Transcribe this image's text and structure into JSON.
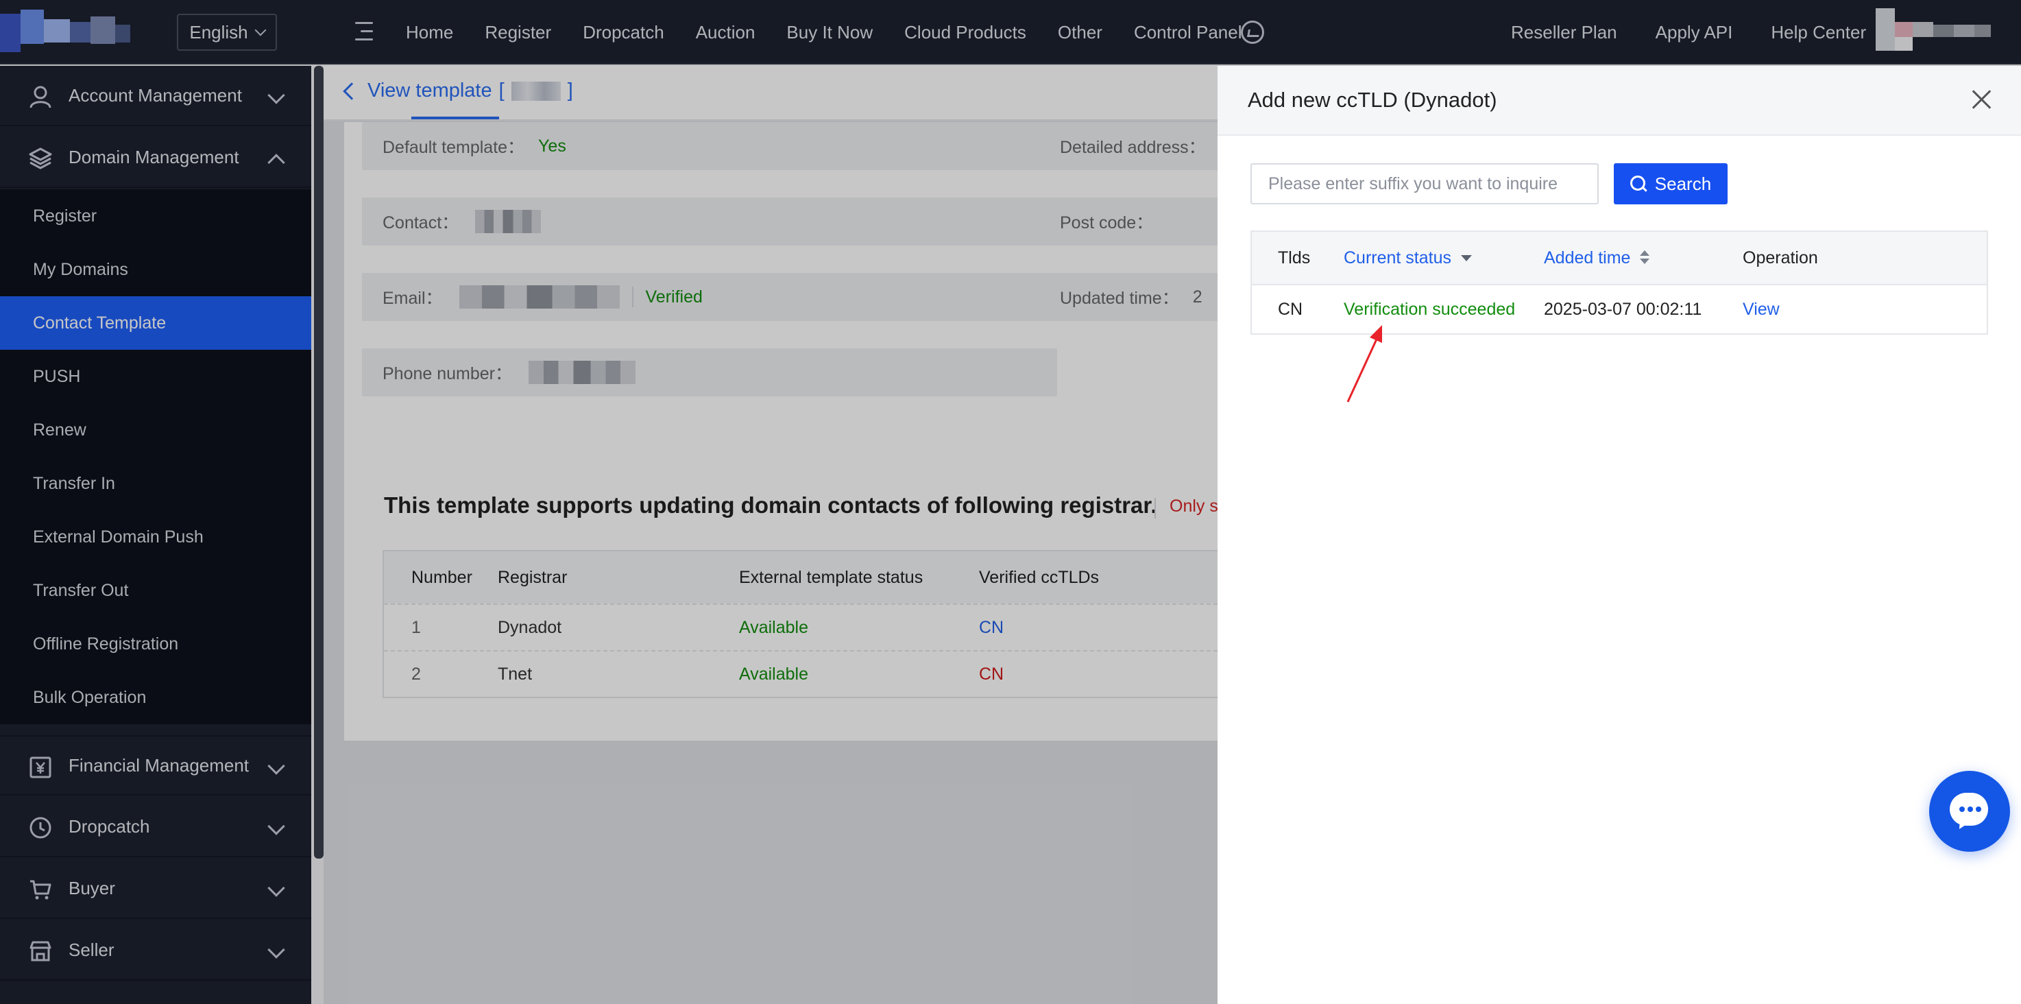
{
  "header": {
    "language": "English",
    "nav": [
      "Home",
      "Register",
      "Dropcatch",
      "Auction",
      "Buy It Now",
      "Cloud Products",
      "Other",
      "Control Panel"
    ],
    "nav_right": [
      "Reseller Plan",
      "Apply API",
      "Help Center"
    ]
  },
  "sidebar": {
    "account": "Account Management",
    "domain": "Domain Management",
    "domain_items": [
      "Register",
      "My Domains",
      "Contact Template",
      "PUSH",
      "Renew",
      "Transfer In",
      "External Domain Push",
      "Transfer Out",
      "Offline Registration",
      "Bulk Operation"
    ],
    "active_item": "Contact Template",
    "financial": "Financial Management",
    "dropcatch": "Dropcatch",
    "buyer": "Buyer",
    "seller": "Seller"
  },
  "main": {
    "breadcrumb": "View template",
    "bracket_open": "[",
    "bracket_close": "]",
    "fields": {
      "default_template_label": "Default template：",
      "default_template_value": "Yes",
      "contact_label": "Contact：",
      "email_label": "Email：",
      "email_status": "Verified",
      "phone_label": "Phone number：",
      "address_label": "Detailed address：",
      "postcode_label": "Post code：",
      "updated_label": "Updated time：",
      "updated_value": "2"
    },
    "registrar_section": {
      "title": "This template supports updating domain contacts of following registrar.",
      "note": "Only stat",
      "columns": [
        "Number",
        "Registrar",
        "External template status",
        "Verified ccTLDs"
      ],
      "rows": [
        {
          "number": "1",
          "registrar": "Dynadot",
          "status": "Available",
          "cctlds": "CN"
        },
        {
          "number": "2",
          "registrar": "Tnet",
          "status": "Available",
          "cctlds": "CN"
        }
      ]
    }
  },
  "drawer": {
    "title": "Add new ccTLD (Dynadot)",
    "search_placeholder": "Please enter suffix you want to inquire",
    "search_button": "Search",
    "columns": {
      "tlds": "Tlds",
      "status": "Current status",
      "added": "Added time",
      "operation": "Operation"
    },
    "rows": [
      {
        "tld": "CN",
        "status": "Verification succeeded",
        "added": "2025-03-07 00:02:11",
        "operation": "View"
      }
    ]
  },
  "colors": {
    "accent": "#1f5ff5",
    "success": "#128c0f",
    "danger": "#cf1b1b",
    "sidebar_bg": "#1d2230",
    "annotation_arrow": "#e8232a"
  },
  "icons": [
    "menu-toggle-icon",
    "cart-icon",
    "user-icon",
    "layers-icon",
    "yen-icon",
    "clock-icon",
    "cart-buyer-icon",
    "store-icon",
    "close-icon",
    "search-icon",
    "chat-icon",
    "annotation-arrow-icon"
  ]
}
